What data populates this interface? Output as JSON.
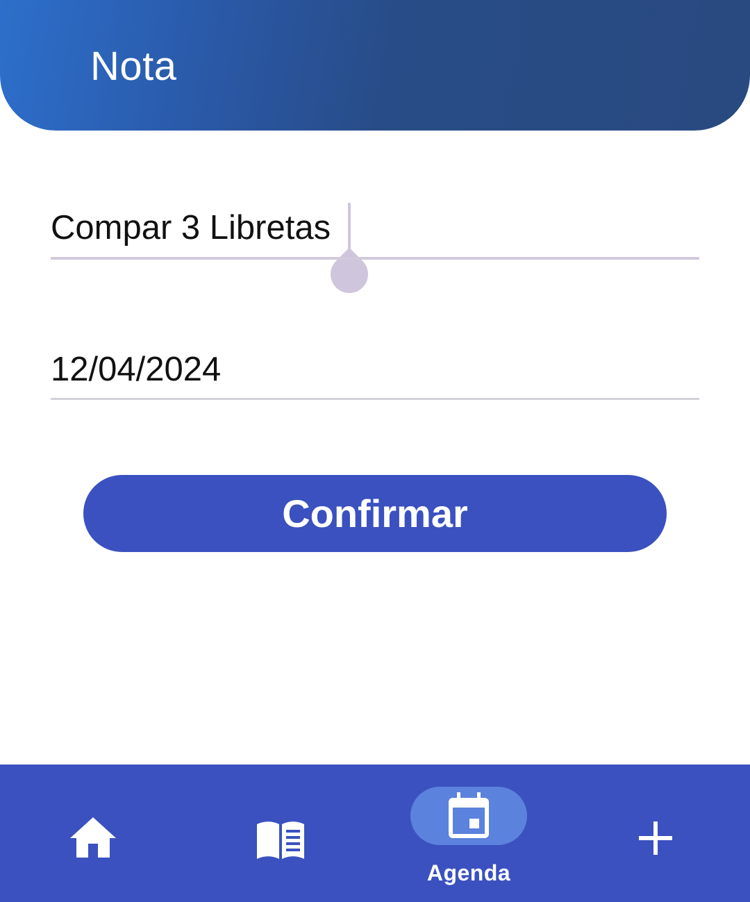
{
  "header": {
    "title": "Nota"
  },
  "form": {
    "note_value": "Compar 3 Libretas",
    "date_value": "12/04/2024"
  },
  "actions": {
    "confirm_label": "Confirmar"
  },
  "bottom_nav": {
    "items": [
      {
        "icon": "home-icon",
        "label": ""
      },
      {
        "icon": "book-icon",
        "label": ""
      },
      {
        "icon": "calendar-icon",
        "label": "Agenda",
        "active": true
      },
      {
        "icon": "plus-icon",
        "label": ""
      }
    ]
  },
  "colors": {
    "header_gradient_start": "#2d6fcb",
    "header_gradient_end": "#294a80",
    "primary": "#3a51bf",
    "active_pill": "#5b82dc",
    "cursor": "#cfc6dd"
  }
}
